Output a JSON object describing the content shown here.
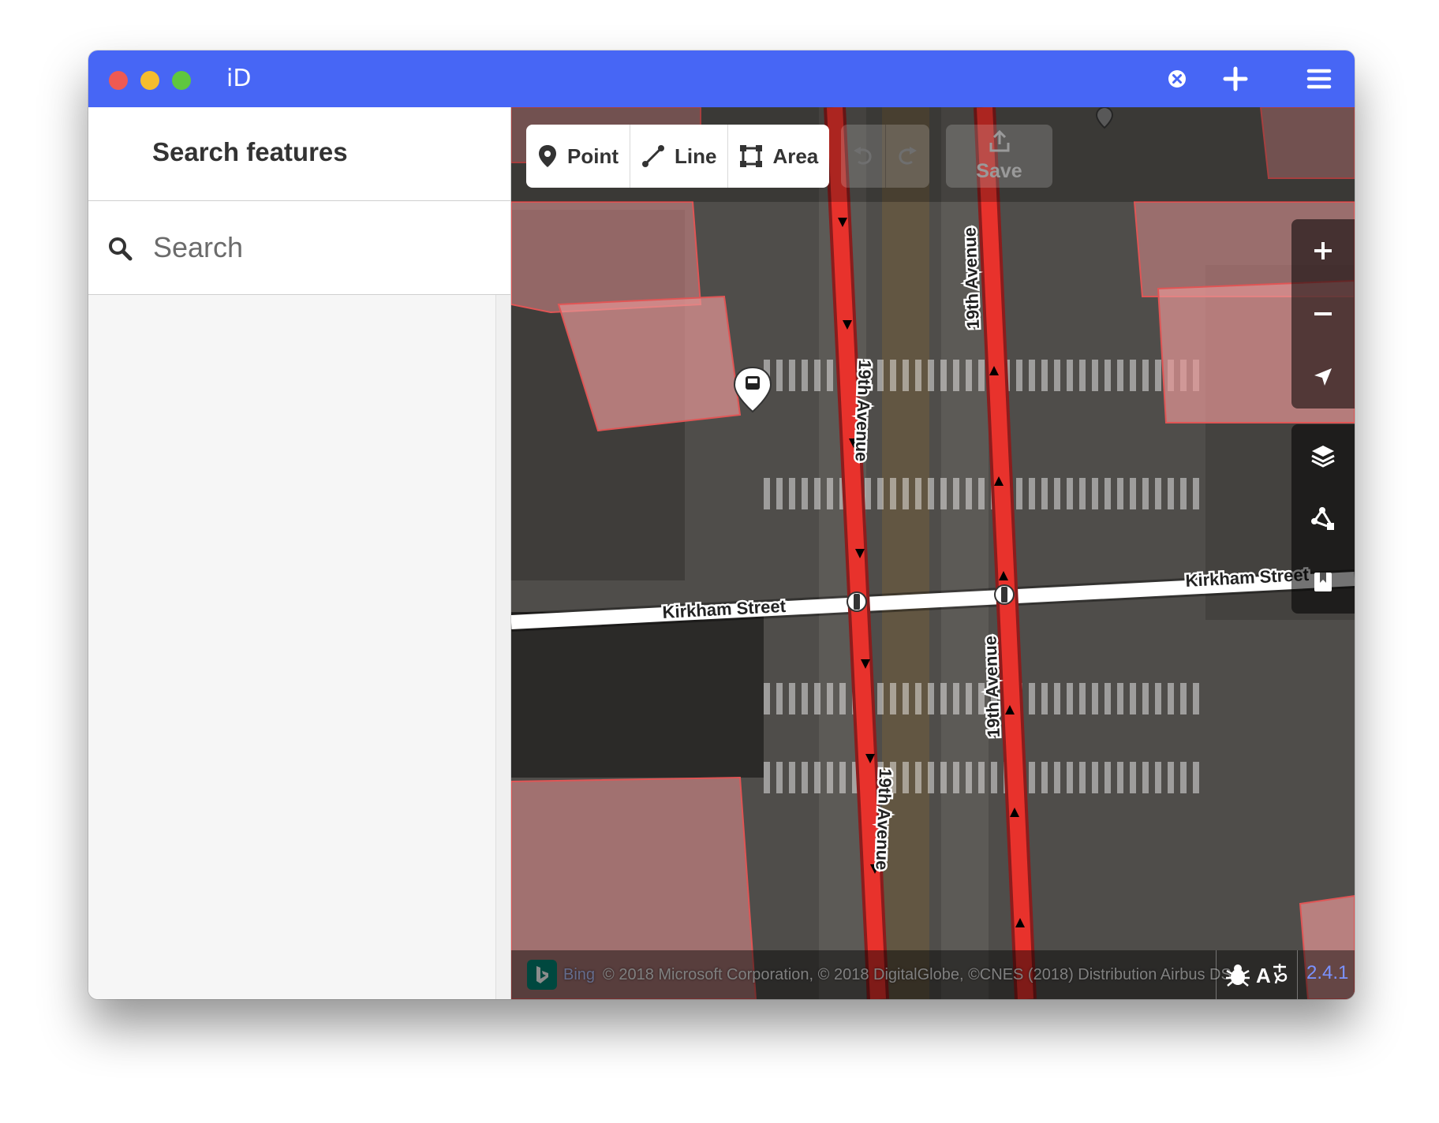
{
  "window": {
    "title": "iD",
    "colors": {
      "titlebar": "#4766f5",
      "accent": "#7a92ff"
    }
  },
  "titlebar_icons": [
    "close-circle-icon",
    "plus-icon",
    "menu-icon"
  ],
  "sidebar": {
    "title": "Search features",
    "search": {
      "placeholder": "Search",
      "value": ""
    }
  },
  "toolbar": {
    "modes": [
      {
        "label": "Point",
        "icon": "point-icon"
      },
      {
        "label": "Line",
        "icon": "line-icon"
      },
      {
        "label": "Area",
        "icon": "area-icon"
      }
    ],
    "history": [
      {
        "icon": "undo-icon",
        "enabled": false
      },
      {
        "icon": "redo-icon",
        "enabled": false
      }
    ],
    "save": {
      "label": "Save",
      "icon": "upload-icon",
      "enabled": false
    }
  },
  "map": {
    "road_labels": {
      "east_west": "Kirkham Street",
      "north_south": "19th Avenue"
    },
    "colors": {
      "buildings": "#d98a8a",
      "transit_route": "#e8322c",
      "street": "#ffffff"
    }
  },
  "map_controls": [
    {
      "name": "zoom-in",
      "icon": "plus-icon"
    },
    {
      "name": "zoom-out",
      "icon": "minus-icon"
    },
    {
      "name": "geolocate",
      "icon": "location-arrow-icon"
    },
    {
      "name": "background",
      "icon": "layers-icon"
    },
    {
      "name": "map-data",
      "icon": "data-icon"
    },
    {
      "name": "help",
      "icon": "help-book-icon"
    }
  ],
  "attribution": {
    "provider": "Bing",
    "text": "© 2018 Microsoft Corporation, © 2018 DigitalGlobe, ©CNES (2018) Distribution Airbus DS"
  },
  "footer": {
    "version": "2.4.1",
    "icons": [
      "bug-icon",
      "translate-icon"
    ]
  }
}
